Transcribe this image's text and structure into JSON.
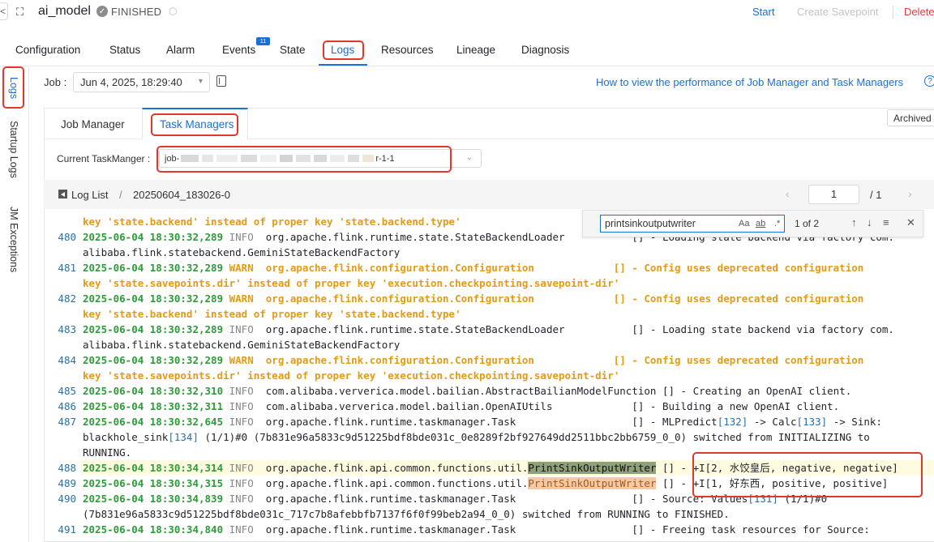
{
  "header": {
    "back_glyph": "<",
    "app_icon_glyph": "⛶",
    "title": "ai_model",
    "status_glyph": "✓",
    "status": "FINISHED",
    "cube_glyph": "⬡",
    "start": "Start",
    "create_savepoint": "Create Savepoint",
    "delete": "Delete"
  },
  "tabs": [
    {
      "label": "Configuration"
    },
    {
      "label": "Status"
    },
    {
      "label": "Alarm"
    },
    {
      "label": "Events",
      "badge": "11"
    },
    {
      "label": "State"
    },
    {
      "label": "Logs"
    },
    {
      "label": "Resources"
    },
    {
      "label": "Lineage"
    },
    {
      "label": "Diagnosis"
    }
  ],
  "vnav": [
    {
      "label": "Logs"
    },
    {
      "label": "Startup Logs"
    },
    {
      "label": "JM Exceptions"
    }
  ],
  "job": {
    "label": "Job :",
    "value": "Jun 4, 2025, 18:29:40",
    "caret": "▾",
    "help_link": "How to view the performance of Job Manager and Task Managers",
    "help_glyph": "?"
  },
  "subtabs": [
    {
      "label": "Job Manager"
    },
    {
      "label": "Task Managers"
    }
  ],
  "archived": "Archived",
  "taskmanager": {
    "label": "Current TaskManger :",
    "value_prefix": "job-",
    "value_suffix": "r-1-1",
    "caret": "⌄"
  },
  "loglist": {
    "link": "Log List",
    "separator": "/",
    "file": "20250604_183026-0",
    "prev": "‹",
    "page": "1",
    "total": "/  1",
    "next": "›"
  },
  "search": {
    "value": "printsinkoutputwriter",
    "opt_case": "Aa",
    "opt_word": "ab",
    "opt_regex": ".*",
    "count": "1 of 2",
    "up": "↑",
    "down": "↓",
    "menu": "≡",
    "close": "✕"
  },
  "logs": [
    {
      "num": "",
      "parts": [
        {
          "c": "warn",
          "t": "key 'state.backend' instead of proper key 'state.backend.type'"
        }
      ]
    },
    {
      "num": "480",
      "parts": [
        {
          "c": "ts",
          "t": "2025-06-04 18:30:32,289"
        },
        {
          "c": "lvl-info",
          "t": " INFO  "
        },
        {
          "c": "cls",
          "t": "org.apache.flink.runtime.state.StateBackendLoader           [] - Loading state backend via factory com."
        }
      ]
    },
    {
      "num": "",
      "parts": [
        {
          "c": "cls",
          "t": "alibaba.flink.statebackend.GeminiStateBackendFactory"
        }
      ]
    },
    {
      "num": "481",
      "parts": [
        {
          "c": "ts",
          "t": "2025-06-04 18:30:32,289"
        },
        {
          "c": "warn",
          "t": " WARN  org.apache.flink.configuration.Configuration             [] - Config uses deprecated configuration"
        }
      ]
    },
    {
      "num": "",
      "parts": [
        {
          "c": "warn",
          "t": "key 'state.savepoints.dir' instead of proper key 'execution.checkpointing.savepoint-dir'"
        }
      ]
    },
    {
      "num": "482",
      "parts": [
        {
          "c": "ts",
          "t": "2025-06-04 18:30:32,289"
        },
        {
          "c": "warn",
          "t": " WARN  org.apache.flink.configuration.Configuration             [] - Config uses deprecated configuration"
        }
      ]
    },
    {
      "num": "",
      "parts": [
        {
          "c": "warn",
          "t": "key 'state.backend' instead of proper key 'state.backend.type'"
        }
      ]
    },
    {
      "num": "483",
      "parts": [
        {
          "c": "ts",
          "t": "2025-06-04 18:30:32,289"
        },
        {
          "c": "lvl-info",
          "t": " INFO  "
        },
        {
          "c": "cls",
          "t": "org.apache.flink.runtime.state.StateBackendLoader           [] - Loading state backend via factory com."
        }
      ]
    },
    {
      "num": "",
      "parts": [
        {
          "c": "cls",
          "t": "alibaba.flink.statebackend.GeminiStateBackendFactory"
        }
      ]
    },
    {
      "num": "484",
      "parts": [
        {
          "c": "ts",
          "t": "2025-06-04 18:30:32,289"
        },
        {
          "c": "warn",
          "t": " WARN  org.apache.flink.configuration.Configuration             [] - Config uses deprecated configuration"
        }
      ]
    },
    {
      "num": "",
      "parts": [
        {
          "c": "warn",
          "t": "key 'state.savepoints.dir' instead of proper key 'execution.checkpointing.savepoint-dir'"
        }
      ]
    },
    {
      "num": "485",
      "parts": [
        {
          "c": "ts",
          "t": "2025-06-04 18:30:32,310"
        },
        {
          "c": "lvl-info",
          "t": " INFO  "
        },
        {
          "c": "cls",
          "t": "com.alibaba.ververica.model.bailian.AbstractBailianModelFunction [] - Creating an OpenAI client."
        }
      ]
    },
    {
      "num": "486",
      "parts": [
        {
          "c": "ts",
          "t": "2025-06-04 18:30:32,311"
        },
        {
          "c": "lvl-info",
          "t": " INFO  "
        },
        {
          "c": "cls",
          "t": "com.alibaba.ververica.model.bailian.OpenAIUtils             [] - Building a new OpenAI client."
        }
      ]
    },
    {
      "num": "487",
      "parts": [
        {
          "c": "ts",
          "t": "2025-06-04 18:30:32,645"
        },
        {
          "c": "lvl-info",
          "t": " INFO  "
        },
        {
          "c": "cls",
          "t": "org.apache.flink.runtime.taskmanager.Task                   [] - MLPredict"
        },
        {
          "c": "bracket",
          "t": "[132]"
        },
        {
          "c": "cls",
          "t": " -> Calc"
        },
        {
          "c": "bracket",
          "t": "[133]"
        },
        {
          "c": "cls",
          "t": " -> Sink:"
        }
      ]
    },
    {
      "num": "",
      "parts": [
        {
          "c": "cls",
          "t": "blackhole_sink"
        },
        {
          "c": "bracket",
          "t": "[134]"
        },
        {
          "c": "cls",
          "t": " (1/1)#0 (7b831e96a5833c9d51225bdf8bde031c_0e8289f2bf927649dd2511bbc2bb6759_0_0) switched from INITIALIZING to"
        }
      ]
    },
    {
      "num": "",
      "parts": [
        {
          "c": "cls",
          "t": "RUNNING."
        }
      ]
    },
    {
      "num": "488",
      "hl": true,
      "parts": [
        {
          "c": "ts",
          "t": "2025-06-04 18:30:34,314"
        },
        {
          "c": "lvl-info",
          "t": " INFO  "
        },
        {
          "c": "cls",
          "t": "org.apache.flink.api.common.functions.util."
        },
        {
          "c": "mark1",
          "t": "PrintSinkOutputWriter"
        },
        {
          "c": "cls",
          "t": " [] - +I[2, 水饺皇后, negative, negative]"
        }
      ]
    },
    {
      "num": "489",
      "parts": [
        {
          "c": "ts",
          "t": "2025-06-04 18:30:34,315"
        },
        {
          "c": "lvl-info",
          "t": " INFO  "
        },
        {
          "c": "cls",
          "t": "org.apache.flink.api.common.functions.util."
        },
        {
          "c": "mark2",
          "t": "PrintSinkOutputWriter"
        },
        {
          "c": "cls",
          "t": " [] - +I[1, 好东西, positive, positive]"
        }
      ]
    },
    {
      "num": "490",
      "parts": [
        {
          "c": "ts",
          "t": "2025-06-04 18:30:34,839"
        },
        {
          "c": "lvl-info",
          "t": " INFO  "
        },
        {
          "c": "cls",
          "t": "org.apache.flink.runtime.taskmanager.Task                   [] - Source: Values"
        },
        {
          "c": "bracket",
          "t": "[131]"
        },
        {
          "c": "cls",
          "t": " (1/1)#0"
        }
      ]
    },
    {
      "num": "",
      "parts": [
        {
          "c": "cls",
          "t": "(7b831e96a5833c9d51225bdf8bde031c_717c7b8afebbfb7137f6f0f99beb2a94_0_0) switched from RUNNING to FINISHED."
        }
      ]
    },
    {
      "num": "491",
      "parts": [
        {
          "c": "ts",
          "t": "2025-06-04 18:30:34,840"
        },
        {
          "c": "lvl-info",
          "t": " INFO  "
        },
        {
          "c": "cls",
          "t": "org.apache.flink.runtime.taskmanager.Task                   [] - Freeing task resources for Source:"
        }
      ]
    }
  ]
}
